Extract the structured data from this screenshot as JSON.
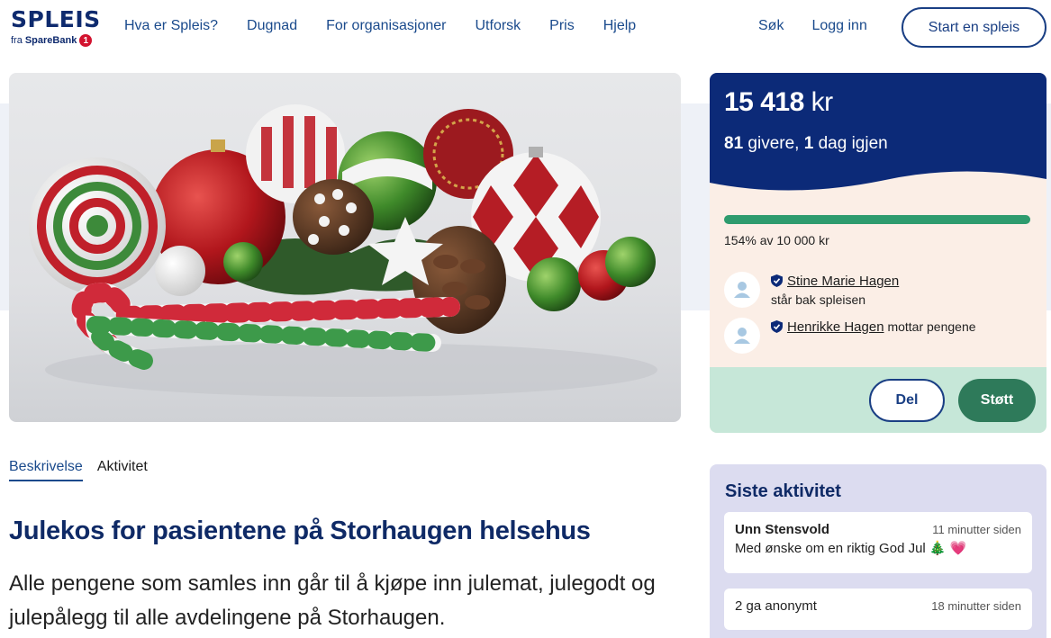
{
  "brand": {
    "name": "SPLEIS",
    "sub_prefix": "fra ",
    "sub_bank": "SpareBank",
    "sub_badge": "1"
  },
  "nav": [
    "Hva er Spleis?",
    "Dugnad",
    "For organisasjoner",
    "Utforsk",
    "Pris",
    "Hjelp"
  ],
  "right_nav": {
    "search": "Søk",
    "login": "Logg inn",
    "start": "Start en spleis"
  },
  "hero": {
    "alt": ""
  },
  "tabs": [
    "Beskrivelse",
    "Aktivitet"
  ],
  "campaign": {
    "title": "Julekos for pasientene på Storhaugen helsehus",
    "description": "Alle pengene som samles inn går til å kjøpe inn julemat, julegodt og julepålegg til alle avdelingene på Storhaugen."
  },
  "card": {
    "amount_value": "15 418",
    "amount_unit": "kr",
    "givers_count": "81",
    "givers_label": " givere, ",
    "days_count": "1",
    "days_label": " dag igjen",
    "progress_fraction": 1.0,
    "progress_text": "154% av 10 000 kr",
    "organizer": {
      "name": "Stine Marie Hagen",
      "role": "står bak spleisen"
    },
    "recipient": {
      "name": "Henrikke Hagen",
      "role": "mottar pengene"
    },
    "share_label": "Del",
    "support_label": "Støtt"
  },
  "activity": {
    "heading": "Siste aktivitet",
    "items": [
      {
        "name": "Unn Stensvold",
        "time": "11 minutter siden",
        "message": "Med ønske om en riktig God Jul 🎄 💗"
      },
      {
        "name": "2 ga anonymt",
        "time": "18 minutter siden"
      }
    ]
  },
  "colors": {
    "navy": "#0c2a78",
    "green": "#2e9b6e",
    "button_green": "#2e7a5a",
    "peach": "#fbeee6",
    "mint": "#c6e7d8",
    "lavender": "#dcdcf0"
  }
}
